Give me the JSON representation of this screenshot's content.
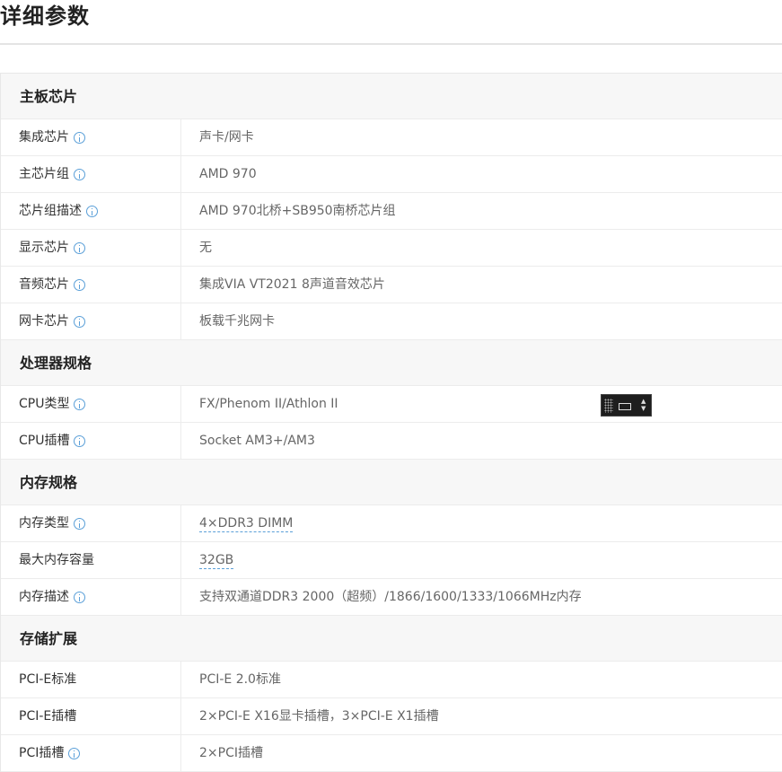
{
  "page": {
    "title": "详细参数"
  },
  "sections": [
    {
      "title": "主板芯片",
      "rows": [
        {
          "label": "集成芯片",
          "value": "声卡/网卡"
        },
        {
          "label": "主芯片组",
          "value": "AMD 970"
        },
        {
          "label": "芯片组描述",
          "value": "AMD 970北桥+SB950南桥芯片组"
        },
        {
          "label": "显示芯片",
          "value": "无"
        },
        {
          "label": "音频芯片",
          "value": "集成VIA VT2021 8声道音效芯片"
        },
        {
          "label": "网卡芯片",
          "value": "板载千兆网卡"
        }
      ]
    },
    {
      "title": "处理器规格",
      "rows": [
        {
          "label": "CPU类型",
          "value": "FX/Phenom II/Athlon II"
        },
        {
          "label": "CPU插槽",
          "value": "Socket AM3+/AM3"
        }
      ]
    },
    {
      "title": "内存规格",
      "rows": [
        {
          "label": "内存类型",
          "value": "4×DDR3 DIMM"
        },
        {
          "label": "最大内存容量",
          "value": "32GB"
        },
        {
          "label": "内存描述",
          "value": "支持双通道DDR3 2000（超频）/1866/1600/1333/1066MHz内存"
        }
      ]
    },
    {
      "title": "存储扩展",
      "rows": [
        {
          "label": "PCI-E标准",
          "value": "PCI-E 2.0标准"
        },
        {
          "label": "PCI-E插槽",
          "value": "2×PCI-E X16显卡插槽，3×PCI-E X1插槽"
        },
        {
          "label": "PCI插槽",
          "value": "2×PCI插槽"
        }
      ]
    }
  ]
}
